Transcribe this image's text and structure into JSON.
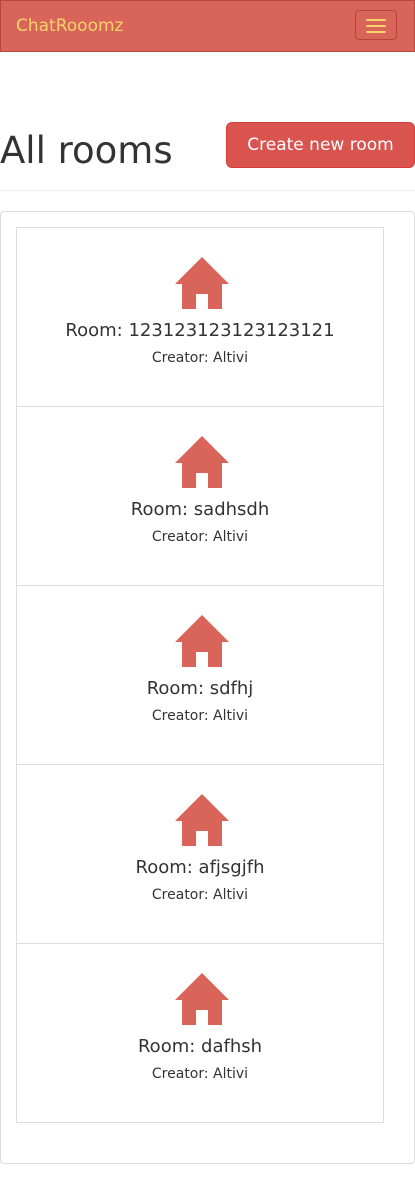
{
  "navbar": {
    "brand": "ChatRooomz",
    "toggle_icon": "hamburger-menu-icon"
  },
  "header": {
    "title": "All rooms",
    "create_button_label": "Create new room"
  },
  "colors": {
    "navbar_bg": "#d9645a",
    "brand_text": "#f6d36b",
    "button_bg": "#d9534f",
    "room_icon": "#d9645a"
  },
  "rooms": [
    {
      "icon": "home-icon",
      "name": "Room: 123123123123123121",
      "creator": "Creator: Altivi"
    },
    {
      "icon": "home-icon",
      "name": "Room: sadhsdh",
      "creator": "Creator: Altivi"
    },
    {
      "icon": "home-icon",
      "name": "Room: sdfhj",
      "creator": "Creator: Altivi"
    },
    {
      "icon": "home-icon",
      "name": "Room: afjsgjfh",
      "creator": "Creator: Altivi"
    },
    {
      "icon": "home-icon",
      "name": "Room: dafhsh",
      "creator": "Creator: Altivi"
    }
  ]
}
